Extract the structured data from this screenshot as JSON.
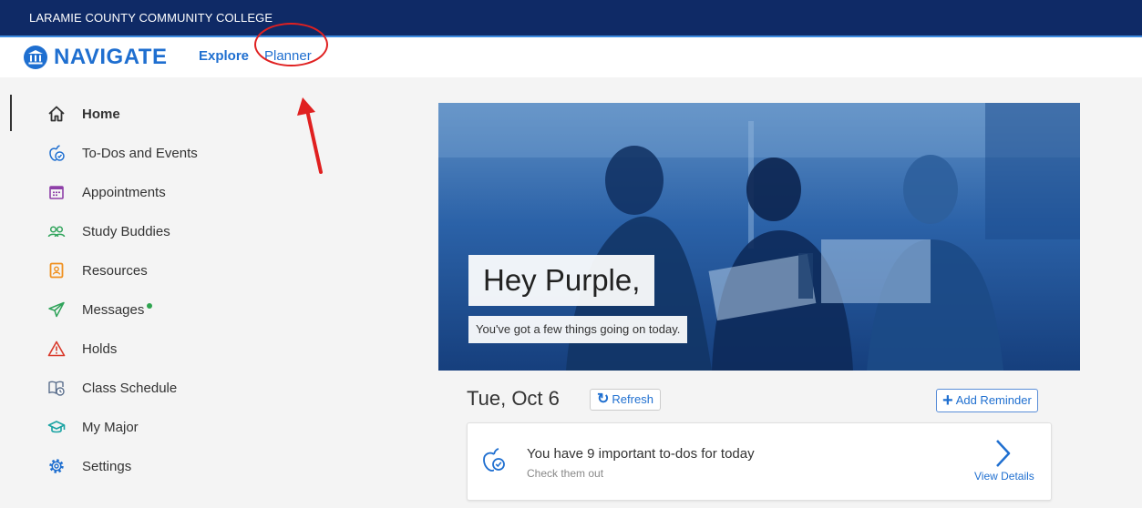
{
  "top_bar": {
    "institution": "LARAMIE COUNTY COMMUNITY COLLEGE"
  },
  "header": {
    "logo_text": "NAVIGATE",
    "nav_explore": "Explore",
    "nav_planner": "Planner"
  },
  "sidebar": {
    "items": [
      {
        "label": "Home",
        "icon": "home-icon",
        "active": true
      },
      {
        "label": "To-Dos and Events",
        "icon": "apple-check-icon"
      },
      {
        "label": "Appointments",
        "icon": "calendar-icon"
      },
      {
        "label": "Study Buddies",
        "icon": "people-icon"
      },
      {
        "label": "Resources",
        "icon": "contact-book-icon"
      },
      {
        "label": "Messages",
        "icon": "paper-plane-icon",
        "unread": true
      },
      {
        "label": "Holds",
        "icon": "warning-icon"
      },
      {
        "label": "Class Schedule",
        "icon": "book-clock-icon"
      },
      {
        "label": "My Major",
        "icon": "graduation-cap-icon"
      },
      {
        "label": "Settings",
        "icon": "gear-icon"
      }
    ]
  },
  "hero": {
    "greeting": "Hey Purple,",
    "subtitle": "You've got a few things going on today."
  },
  "today": {
    "date": "Tue, Oct 6",
    "refresh_label": "Refresh",
    "add_reminder_label": "Add Reminder"
  },
  "todo_card": {
    "title": "You have 9 important to-dos for today",
    "subtitle": "Check them out",
    "action": "View Details"
  },
  "colors": {
    "top_bar": "#0f2a66",
    "brand_blue": "#1f6fd0",
    "annotation_red": "#e02020"
  }
}
